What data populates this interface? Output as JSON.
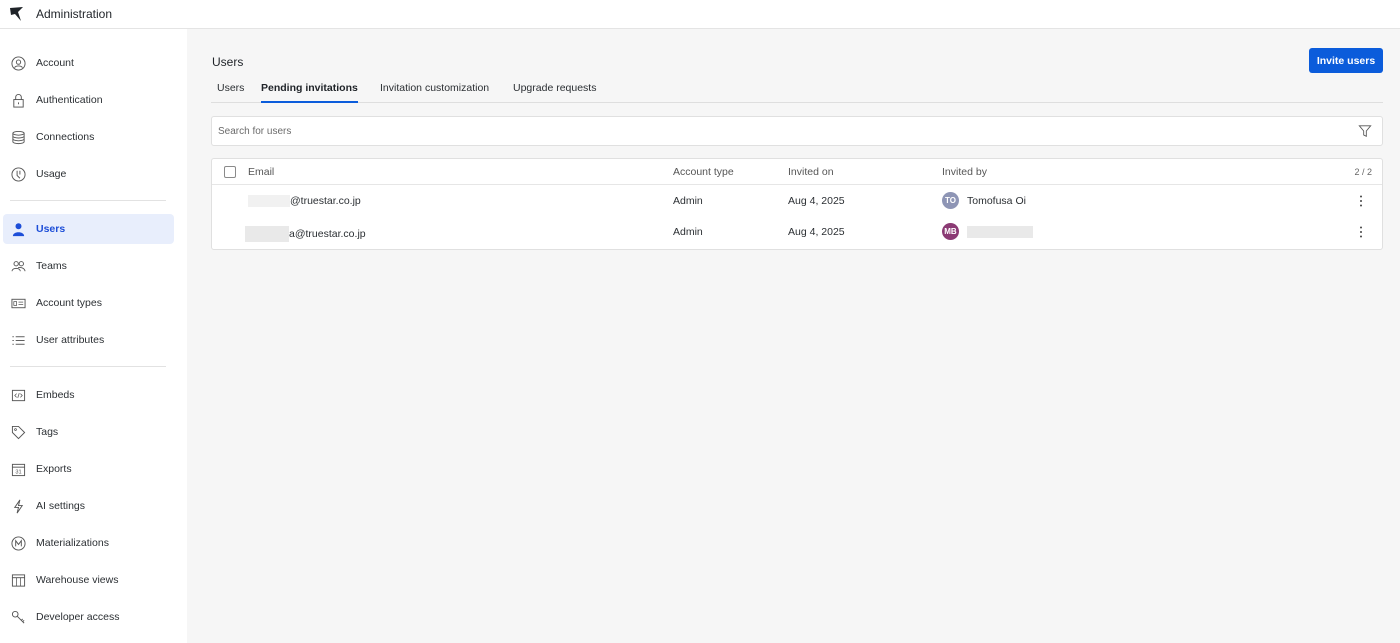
{
  "app": {
    "title": "Administration"
  },
  "sidebar": {
    "items": [
      {
        "label": "Account",
        "icon": "account-circle-icon"
      },
      {
        "label": "Authentication",
        "icon": "lock-icon"
      },
      {
        "label": "Connections",
        "icon": "database-icon"
      },
      {
        "label": "Usage",
        "icon": "usage-gauge-icon"
      },
      {
        "label": "Users",
        "icon": "user-icon",
        "active": true
      },
      {
        "label": "Teams",
        "icon": "teams-icon"
      },
      {
        "label": "Account types",
        "icon": "id-card-icon"
      },
      {
        "label": "User attributes",
        "icon": "list-icon"
      },
      {
        "label": "Embeds",
        "icon": "code-icon"
      },
      {
        "label": "Tags",
        "icon": "tag-icon"
      },
      {
        "label": "Exports",
        "icon": "calendar-icon"
      },
      {
        "label": "AI settings",
        "icon": "lightning-icon"
      },
      {
        "label": "Materializations",
        "icon": "m-circle-icon"
      },
      {
        "label": "Warehouse views",
        "icon": "table-icon"
      },
      {
        "label": "Developer access",
        "icon": "key-icon"
      }
    ]
  },
  "page": {
    "title": "Users",
    "invite_button": "Invite users",
    "tabs": [
      {
        "label": "Users"
      },
      {
        "label": "Pending invitations",
        "active": true
      },
      {
        "label": "Invitation customization"
      },
      {
        "label": "Upgrade requests"
      }
    ],
    "search_placeholder": "Search for users"
  },
  "table": {
    "columns": {
      "email": "Email",
      "account_type": "Account type",
      "invited_on": "Invited on",
      "invited_by": "Invited by"
    },
    "count": "2 / 2",
    "rows": [
      {
        "email": "@truestar.co.jp",
        "account_type": "Admin",
        "invited_on": "Aug 4, 2025",
        "inviter_initials": "TO",
        "inviter_name": "Tomofusa Oi",
        "avatar_color": "#8e95b5"
      },
      {
        "email": "a@truestar.co.jp",
        "account_type": "Admin",
        "invited_on": "Aug 4, 2025",
        "inviter_initials": "MB",
        "inviter_name": "",
        "avatar_color": "#8b3a74"
      }
    ]
  },
  "colors": {
    "accent": "#0b5cdb",
    "active_nav_bg": "#e8eefc"
  }
}
